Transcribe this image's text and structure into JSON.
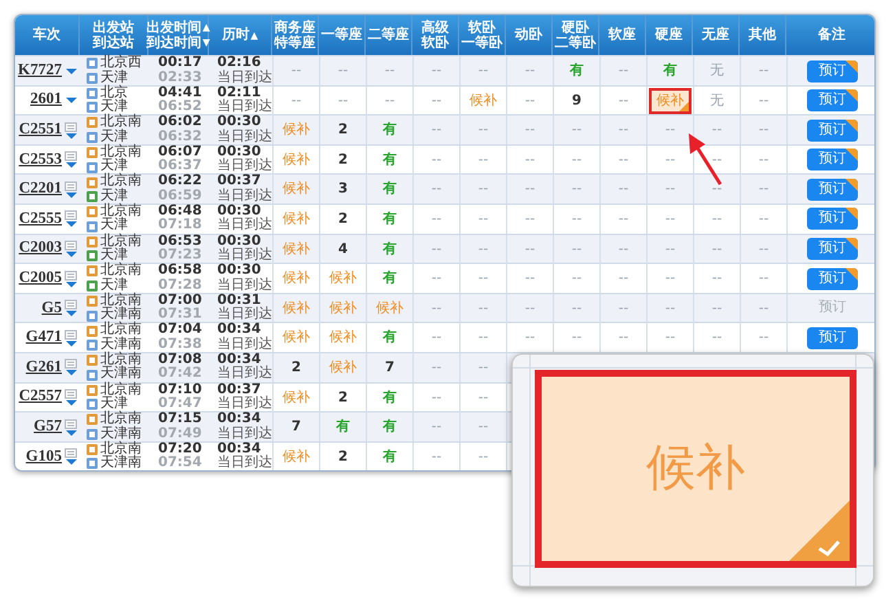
{
  "columns": [
    {
      "lines": [
        {
          "text": "车次"
        }
      ]
    },
    {
      "lines": [
        {
          "text": "出发站"
        },
        {
          "text": "到达站"
        }
      ]
    },
    {
      "lines": [
        {
          "text": "出发时间",
          "sort": "▲"
        },
        {
          "text": "到达时间",
          "sort": "▼"
        }
      ]
    },
    {
      "lines": [
        {
          "text": "历时",
          "sort": "▲"
        }
      ]
    },
    {
      "lines": [
        {
          "text": "商务座"
        },
        {
          "text": "特等座"
        }
      ]
    },
    {
      "lines": [
        {
          "text": "一等座"
        }
      ]
    },
    {
      "lines": [
        {
          "text": "二等座"
        }
      ]
    },
    {
      "lines": [
        {
          "text": "高级"
        },
        {
          "text": "软卧"
        }
      ]
    },
    {
      "lines": [
        {
          "text": "软卧"
        },
        {
          "text": "一等卧"
        }
      ]
    },
    {
      "lines": [
        {
          "text": "动卧"
        }
      ]
    },
    {
      "lines": [
        {
          "text": "硬卧"
        },
        {
          "text": "二等卧"
        }
      ]
    },
    {
      "lines": [
        {
          "text": "软座"
        }
      ]
    },
    {
      "lines": [
        {
          "text": "硬座"
        }
      ]
    },
    {
      "lines": [
        {
          "text": "无座"
        }
      ]
    },
    {
      "lines": [
        {
          "text": "其他"
        }
      ]
    },
    {
      "lines": [
        {
          "text": "备注"
        }
      ]
    }
  ],
  "rows": [
    {
      "train": "K7727",
      "stops_icon": false,
      "from": {
        "name": "北京西",
        "kind": "pass"
      },
      "to": {
        "name": "天津",
        "kind": "pass"
      },
      "depart": "00:17",
      "arrive": "02:33",
      "duration": "02:16",
      "arrival_day": "当日到达",
      "seats": [
        {
          "text": "--",
          "kind": "none"
        },
        {
          "text": "--",
          "kind": "none"
        },
        {
          "text": "--",
          "kind": "none"
        },
        {
          "text": "--",
          "kind": "none"
        },
        {
          "text": "--",
          "kind": "none"
        },
        {
          "text": "--",
          "kind": "none"
        },
        {
          "text": "有",
          "kind": "available"
        },
        {
          "text": "--",
          "kind": "none"
        },
        {
          "text": "有",
          "kind": "available"
        },
        {
          "text": "无",
          "kind": "sold_out"
        },
        {
          "text": "--",
          "kind": "none"
        }
      ],
      "action": {
        "label": "预订",
        "disabled": false,
        "corner_badge": true
      }
    },
    {
      "train": "2601",
      "stops_icon": false,
      "from": {
        "name": "北京",
        "kind": "pass"
      },
      "to": {
        "name": "天津",
        "kind": "pass"
      },
      "depart": "04:41",
      "arrive": "06:52",
      "duration": "02:11",
      "arrival_day": "当日到达",
      "seats": [
        {
          "text": "--",
          "kind": "none"
        },
        {
          "text": "--",
          "kind": "none"
        },
        {
          "text": "--",
          "kind": "none"
        },
        {
          "text": "--",
          "kind": "none"
        },
        {
          "text": "候补",
          "kind": "waitlist"
        },
        {
          "text": "--",
          "kind": "none"
        },
        {
          "text": "9",
          "kind": "count"
        },
        {
          "text": "--",
          "kind": "none"
        },
        {
          "text": "候补",
          "kind": "waitlist",
          "highlighted": true
        },
        {
          "text": "无",
          "kind": "sold_out"
        },
        {
          "text": "--",
          "kind": "none"
        }
      ],
      "action": {
        "label": "预订",
        "disabled": false,
        "corner_badge": true
      }
    },
    {
      "train": "C2551",
      "stops_icon": true,
      "from": {
        "name": "北京南",
        "kind": "start"
      },
      "to": {
        "name": "天津",
        "kind": "pass"
      },
      "depart": "06:02",
      "arrive": "06:32",
      "duration": "00:30",
      "arrival_day": "当日到达",
      "seats": [
        {
          "text": "候补",
          "kind": "waitlist"
        },
        {
          "text": "2",
          "kind": "count"
        },
        {
          "text": "有",
          "kind": "available"
        },
        {
          "text": "--",
          "kind": "none"
        },
        {
          "text": "--",
          "kind": "none"
        },
        {
          "text": "--",
          "kind": "none"
        },
        {
          "text": "--",
          "kind": "none"
        },
        {
          "text": "--",
          "kind": "none"
        },
        {
          "text": "--",
          "kind": "none"
        },
        {
          "text": "--",
          "kind": "none"
        },
        {
          "text": "--",
          "kind": "none"
        }
      ],
      "action": {
        "label": "预订",
        "disabled": false,
        "corner_badge": true
      }
    },
    {
      "train": "C2553",
      "stops_icon": true,
      "from": {
        "name": "北京南",
        "kind": "start"
      },
      "to": {
        "name": "天津",
        "kind": "pass"
      },
      "depart": "06:07",
      "arrive": "06:37",
      "duration": "00:30",
      "arrival_day": "当日到达",
      "seats": [
        {
          "text": "候补",
          "kind": "waitlist"
        },
        {
          "text": "2",
          "kind": "count"
        },
        {
          "text": "有",
          "kind": "available"
        },
        {
          "text": "--",
          "kind": "none"
        },
        {
          "text": "--",
          "kind": "none"
        },
        {
          "text": "--",
          "kind": "none"
        },
        {
          "text": "--",
          "kind": "none"
        },
        {
          "text": "--",
          "kind": "none"
        },
        {
          "text": "--",
          "kind": "none"
        },
        {
          "text": "--",
          "kind": "none"
        },
        {
          "text": "--",
          "kind": "none"
        }
      ],
      "action": {
        "label": "预订",
        "disabled": false,
        "corner_badge": true
      }
    },
    {
      "train": "C2201",
      "stops_icon": true,
      "from": {
        "name": "北京南",
        "kind": "start"
      },
      "to": {
        "name": "天津",
        "kind": "end"
      },
      "depart": "06:22",
      "arrive": "06:59",
      "duration": "00:37",
      "arrival_day": "当日到达",
      "seats": [
        {
          "text": "候补",
          "kind": "waitlist"
        },
        {
          "text": "3",
          "kind": "count"
        },
        {
          "text": "有",
          "kind": "available"
        },
        {
          "text": "--",
          "kind": "none"
        },
        {
          "text": "--",
          "kind": "none"
        },
        {
          "text": "--",
          "kind": "none"
        },
        {
          "text": "--",
          "kind": "none"
        },
        {
          "text": "--",
          "kind": "none"
        },
        {
          "text": "--",
          "kind": "none"
        },
        {
          "text": "--",
          "kind": "none"
        },
        {
          "text": "--",
          "kind": "none"
        }
      ],
      "action": {
        "label": "预订",
        "disabled": false,
        "corner_badge": true
      }
    },
    {
      "train": "C2555",
      "stops_icon": true,
      "from": {
        "name": "北京南",
        "kind": "start"
      },
      "to": {
        "name": "天津",
        "kind": "pass"
      },
      "depart": "06:48",
      "arrive": "07:18",
      "duration": "00:30",
      "arrival_day": "当日到达",
      "seats": [
        {
          "text": "候补",
          "kind": "waitlist"
        },
        {
          "text": "2",
          "kind": "count"
        },
        {
          "text": "有",
          "kind": "available"
        },
        {
          "text": "--",
          "kind": "none"
        },
        {
          "text": "--",
          "kind": "none"
        },
        {
          "text": "--",
          "kind": "none"
        },
        {
          "text": "--",
          "kind": "none"
        },
        {
          "text": "--",
          "kind": "none"
        },
        {
          "text": "--",
          "kind": "none"
        },
        {
          "text": "--",
          "kind": "none"
        },
        {
          "text": "--",
          "kind": "none"
        }
      ],
      "action": {
        "label": "预订",
        "disabled": false,
        "corner_badge": true
      }
    },
    {
      "train": "C2003",
      "stops_icon": true,
      "from": {
        "name": "北京南",
        "kind": "start"
      },
      "to": {
        "name": "天津",
        "kind": "end"
      },
      "depart": "06:53",
      "arrive": "07:23",
      "duration": "00:30",
      "arrival_day": "当日到达",
      "seats": [
        {
          "text": "候补",
          "kind": "waitlist"
        },
        {
          "text": "4",
          "kind": "count"
        },
        {
          "text": "有",
          "kind": "available"
        },
        {
          "text": "--",
          "kind": "none"
        },
        {
          "text": "--",
          "kind": "none"
        },
        {
          "text": "--",
          "kind": "none"
        },
        {
          "text": "--",
          "kind": "none"
        },
        {
          "text": "--",
          "kind": "none"
        },
        {
          "text": "--",
          "kind": "none"
        },
        {
          "text": "--",
          "kind": "none"
        },
        {
          "text": "--",
          "kind": "none"
        }
      ],
      "action": {
        "label": "预订",
        "disabled": false,
        "corner_badge": true
      }
    },
    {
      "train": "C2005",
      "stops_icon": true,
      "from": {
        "name": "北京南",
        "kind": "start"
      },
      "to": {
        "name": "天津",
        "kind": "end"
      },
      "depart": "06:58",
      "arrive": "07:28",
      "duration": "00:30",
      "arrival_day": "当日到达",
      "seats": [
        {
          "text": "候补",
          "kind": "waitlist"
        },
        {
          "text": "候补",
          "kind": "waitlist"
        },
        {
          "text": "有",
          "kind": "available"
        },
        {
          "text": "--",
          "kind": "none"
        },
        {
          "text": "--",
          "kind": "none"
        },
        {
          "text": "--",
          "kind": "none"
        },
        {
          "text": "--",
          "kind": "none"
        },
        {
          "text": "--",
          "kind": "none"
        },
        {
          "text": "--",
          "kind": "none"
        },
        {
          "text": "--",
          "kind": "none"
        },
        {
          "text": "--",
          "kind": "none"
        }
      ],
      "action": {
        "label": "预订",
        "disabled": false,
        "corner_badge": true
      }
    },
    {
      "train": "G5",
      "stops_icon": true,
      "from": {
        "name": "北京南",
        "kind": "start"
      },
      "to": {
        "name": "天津南",
        "kind": "pass"
      },
      "depart": "07:00",
      "arrive": "07:31",
      "duration": "00:31",
      "arrival_day": "当日到达",
      "seats": [
        {
          "text": "候补",
          "kind": "waitlist"
        },
        {
          "text": "候补",
          "kind": "waitlist"
        },
        {
          "text": "候补",
          "kind": "waitlist"
        },
        {
          "text": "--",
          "kind": "none"
        },
        {
          "text": "--",
          "kind": "none"
        },
        {
          "text": "--",
          "kind": "none"
        },
        {
          "text": "--",
          "kind": "none"
        },
        {
          "text": "--",
          "kind": "none"
        },
        {
          "text": "--",
          "kind": "none"
        },
        {
          "text": "--",
          "kind": "none"
        },
        {
          "text": "--",
          "kind": "none"
        }
      ],
      "action": {
        "label": "预订",
        "disabled": true,
        "corner_badge": false
      }
    },
    {
      "train": "G471",
      "stops_icon": true,
      "from": {
        "name": "北京南",
        "kind": "start"
      },
      "to": {
        "name": "天津南",
        "kind": "pass"
      },
      "depart": "07:04",
      "arrive": "07:38",
      "duration": "00:34",
      "arrival_day": "当日到达",
      "seats": [
        {
          "text": "候补",
          "kind": "waitlist"
        },
        {
          "text": "候补",
          "kind": "waitlist"
        },
        {
          "text": "有",
          "kind": "available"
        },
        {
          "text": "--",
          "kind": "none"
        },
        {
          "text": "--",
          "kind": "none"
        },
        {
          "text": "--",
          "kind": "none"
        },
        {
          "text": "--",
          "kind": "none"
        },
        {
          "text": "--",
          "kind": "none"
        },
        {
          "text": "--",
          "kind": "none"
        },
        {
          "text": "--",
          "kind": "none"
        },
        {
          "text": "--",
          "kind": "none"
        }
      ],
      "action": {
        "label": "预订",
        "disabled": false,
        "corner_badge": false
      }
    },
    {
      "train": "G261",
      "stops_icon": true,
      "from": {
        "name": "北京南",
        "kind": "start"
      },
      "to": {
        "name": "天津南",
        "kind": "pass"
      },
      "depart": "07:08",
      "arrive": "07:42",
      "duration": "00:34",
      "arrival_day": "当日到达",
      "seats": [
        {
          "text": "2",
          "kind": "count"
        },
        {
          "text": "候补",
          "kind": "waitlist"
        },
        {
          "text": "7",
          "kind": "count"
        },
        {
          "text": "--",
          "kind": "none"
        },
        {
          "text": "--",
          "kind": "none"
        }
      ]
    },
    {
      "train": "C2557",
      "stops_icon": true,
      "from": {
        "name": "北京南",
        "kind": "start"
      },
      "to": {
        "name": "天津",
        "kind": "pass"
      },
      "depart": "07:10",
      "arrive": "07:47",
      "duration": "00:37",
      "arrival_day": "当日到达",
      "seats": [
        {
          "text": "候补",
          "kind": "waitlist"
        },
        {
          "text": "2",
          "kind": "count"
        },
        {
          "text": "有",
          "kind": "available"
        },
        {
          "text": "--",
          "kind": "none"
        },
        {
          "text": "--",
          "kind": "none"
        }
      ]
    },
    {
      "train": "G57",
      "stops_icon": true,
      "from": {
        "name": "北京南",
        "kind": "start"
      },
      "to": {
        "name": "天津南",
        "kind": "pass"
      },
      "depart": "07:15",
      "arrive": "07:49",
      "duration": "00:34",
      "arrival_day": "当日到达",
      "seats": [
        {
          "text": "7",
          "kind": "count"
        },
        {
          "text": "有",
          "kind": "available"
        },
        {
          "text": "有",
          "kind": "available"
        },
        {
          "text": "--",
          "kind": "none"
        },
        {
          "text": "--",
          "kind": "none"
        }
      ]
    },
    {
      "train": "G105",
      "stops_icon": true,
      "from": {
        "name": "北京南",
        "kind": "start"
      },
      "to": {
        "name": "天津南",
        "kind": "pass"
      },
      "depart": "07:20",
      "arrive": "07:54",
      "duration": "00:34",
      "arrival_day": "当日到达",
      "seats": [
        {
          "text": "候补",
          "kind": "waitlist"
        },
        {
          "text": "2",
          "kind": "count"
        },
        {
          "text": "有",
          "kind": "available"
        },
        {
          "text": "--",
          "kind": "none"
        },
        {
          "text": "--",
          "kind": "none"
        }
      ]
    }
  ],
  "zoom_inset": {
    "text": "候补"
  }
}
